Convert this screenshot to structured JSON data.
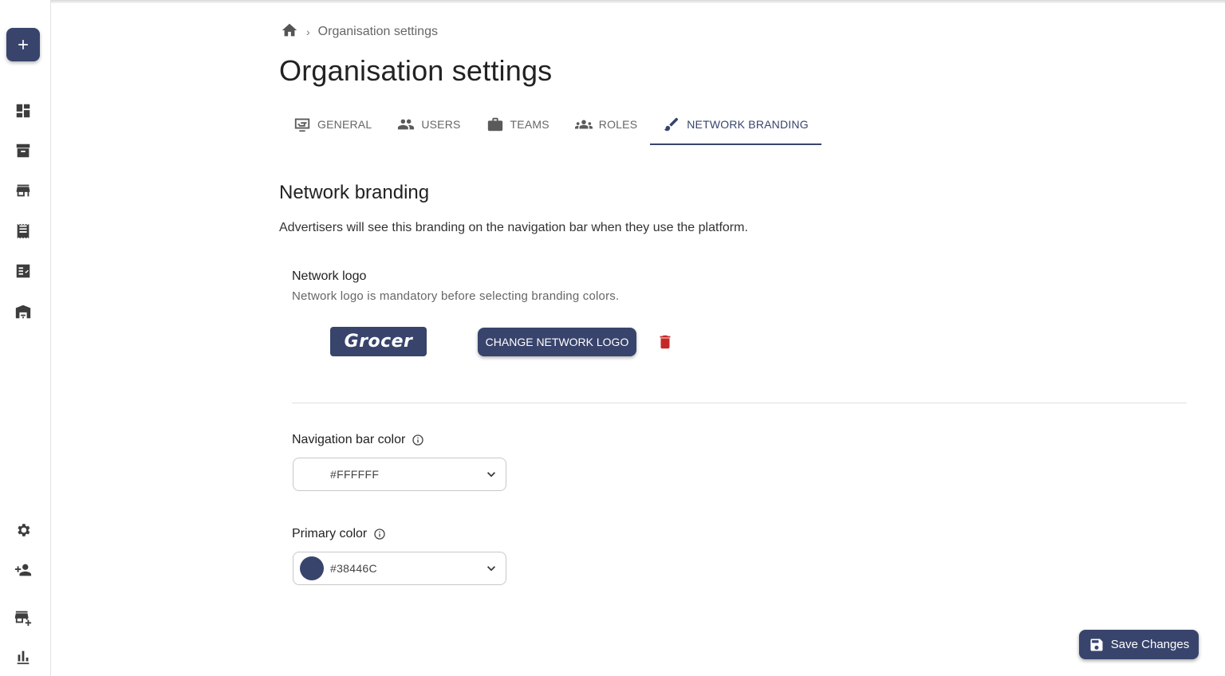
{
  "breadcrumb": {
    "home_icon": "home-icon",
    "separator": "›",
    "current": "Organisation settings"
  },
  "page": {
    "title": "Organisation settings"
  },
  "tabs": [
    {
      "label": "GENERAL",
      "icon": "settings-card-icon",
      "active": false
    },
    {
      "label": "USERS",
      "icon": "people-icon",
      "active": false
    },
    {
      "label": "TEAMS",
      "icon": "briefcase-icon",
      "active": false
    },
    {
      "label": "ROLES",
      "icon": "groups-icon",
      "active": false
    },
    {
      "label": "NETWORK BRANDING",
      "icon": "brush-icon",
      "active": true
    }
  ],
  "section": {
    "title": "Network branding",
    "description": "Advertisers will see this branding on the navigation bar when they use the platform."
  },
  "logo": {
    "label": "Network logo",
    "help": "Network logo is mandatory before selecting branding colors.",
    "brand_text": "Grocer",
    "change_label": "CHANGE NETWORK LOGO"
  },
  "nav_color": {
    "label": "Navigation bar color",
    "value": "#FFFFFF",
    "swatch": "#FFFFFF"
  },
  "primary_color": {
    "label": "Primary color",
    "value": "#38446C",
    "swatch": "#38446C"
  },
  "save": {
    "label": "Save Changes"
  },
  "colors": {
    "accent": "#38446C",
    "danger": "#C62828"
  },
  "sidebar": {
    "top_icons": [
      "dashboard-icon",
      "archive-icon",
      "store-icon",
      "receipt-icon",
      "checklist-icon",
      "warehouse-icon"
    ],
    "bottom_icons": [
      "settings-icon",
      "add-user-icon",
      "add-store-icon",
      "bar-chart-icon"
    ]
  }
}
